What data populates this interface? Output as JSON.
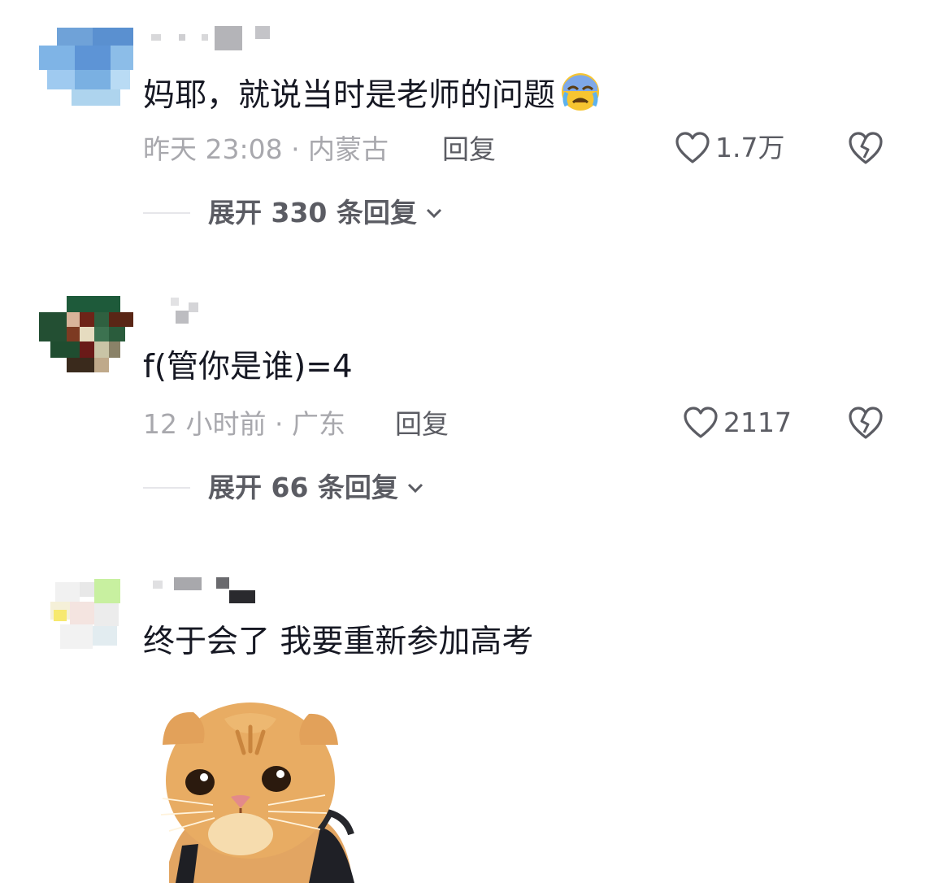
{
  "comments": [
    {
      "text": "妈耶，就说当时是老师的问题",
      "emoji": "😭",
      "meta": "昨天 23:08 · 内蒙古",
      "reply_label": "回复",
      "likes": "1.7万",
      "expand_label": "展开 330 条回复"
    },
    {
      "text": "f(管你是谁)=4",
      "meta": "12 小时前 · 广东",
      "reply_label": "回复",
      "likes": "2117",
      "expand_label": "展开 66 条回复"
    },
    {
      "text": "终于会了 我要重新参加高考"
    }
  ],
  "colors": {
    "primary_text": "#161823",
    "secondary_text": "#a8a8ad",
    "action_text": "#5b5c63"
  },
  "icons": [
    "heart-icon",
    "broken-heart-icon",
    "chevron-down-icon",
    "crying-face-emoji",
    "cat-sticker"
  ]
}
